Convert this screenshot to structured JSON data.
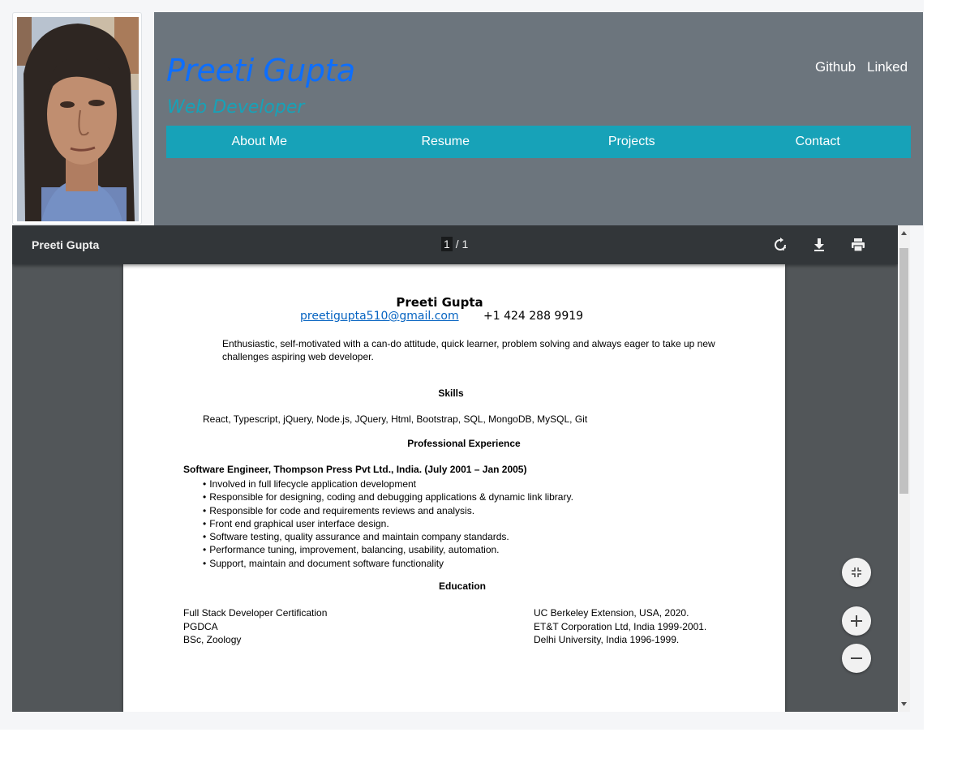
{
  "profile": {
    "photo_alt": "Preeti Gupta profile photo",
    "name": "Preeti Gupta",
    "role": "Web Developer"
  },
  "social": {
    "github": "Github",
    "linkedin": "Linked"
  },
  "nav": {
    "items": [
      {
        "label": "About Me"
      },
      {
        "label": "Resume"
      },
      {
        "label": "Projects"
      },
      {
        "label": "Contact"
      }
    ]
  },
  "viewer": {
    "title": "Preeti Gupta",
    "page_current": "1",
    "page_total": "/ 1",
    "icons": [
      "rotate-icon",
      "download-icon",
      "print-icon",
      "fit-page-icon",
      "zoom-in-icon",
      "zoom-out-icon"
    ]
  },
  "resume": {
    "name": "Preeti Gupta",
    "email": "preetigupta510@gmail.com",
    "phone": "+1 424 288 9919",
    "summary": "Enthusiastic, self-motivated with a can-do attitude, quick learner, problem solving and always eager to take up new challenges aspiring web developer.",
    "skills_heading": "Skills",
    "skills": "React, Typescript, jQuery, Node.js, JQuery, Html, Bootstrap, SQL, MongoDB, MySQL, Git",
    "experience_heading": "Professional Experience",
    "job_title": "Software Engineer, Thompson Press Pvt Ltd., India. (July 2001 – Jan 2005)",
    "bullets": [
      "Involved in full lifecycle application development",
      "Responsible for designing, coding and debugging applications & dynamic link library.",
      "Responsible for code and requirements reviews and analysis.",
      "Front end graphical user interface design.",
      "Software testing, quality assurance and maintain company standards.",
      "Performance tuning, improvement, balancing, usability, automation.",
      "Support, maintain and document software functionality"
    ],
    "education_heading": "Education",
    "education": [
      {
        "degree": "Full Stack Developer Certification",
        "institution": "UC Berkeley Extension, USA, 2020."
      },
      {
        "degree": "PGDCA",
        "institution": "ET&T Corporation Ltd, India 1999-2001."
      },
      {
        "degree": "BSc, Zoology",
        "institution": "Delhi University, India 1996-1999."
      }
    ]
  },
  "colors": {
    "header_bg": "#6c757d",
    "nav_bg": "#17a2b8",
    "name_color": "#0d6efd",
    "role_color": "#17a2b8",
    "viewer_toolbar": "#323639",
    "viewer_bg": "#525659"
  }
}
